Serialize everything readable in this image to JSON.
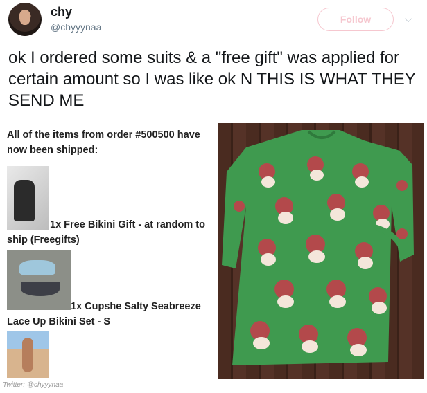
{
  "user": {
    "display_name": "chy",
    "handle": "@chyyynaa",
    "follow_label": "Follow",
    "avatar_icon": "avatar"
  },
  "tweet": {
    "text": "ok I ordered some suits & a \"free gift\" was applied for certain amount so I was like ok N THIS IS WHAT THEY SEND ME"
  },
  "email": {
    "intro": "All of the items from order #500500 have now been shipped:",
    "items": [
      {
        "label": "1x Free Bikini Gift - at random to ship (Freegifts)"
      },
      {
        "label": "1x Cupshe Salty Seabreeze Lace Up Bikini Set - S"
      }
    ]
  },
  "credit": "Twitter: @chyyynaa",
  "colors": {
    "follow_border": "#f6c7cf",
    "handle": "#657786",
    "dress_green": "#3f9a4f",
    "dress_print_red": "#c0414b"
  }
}
